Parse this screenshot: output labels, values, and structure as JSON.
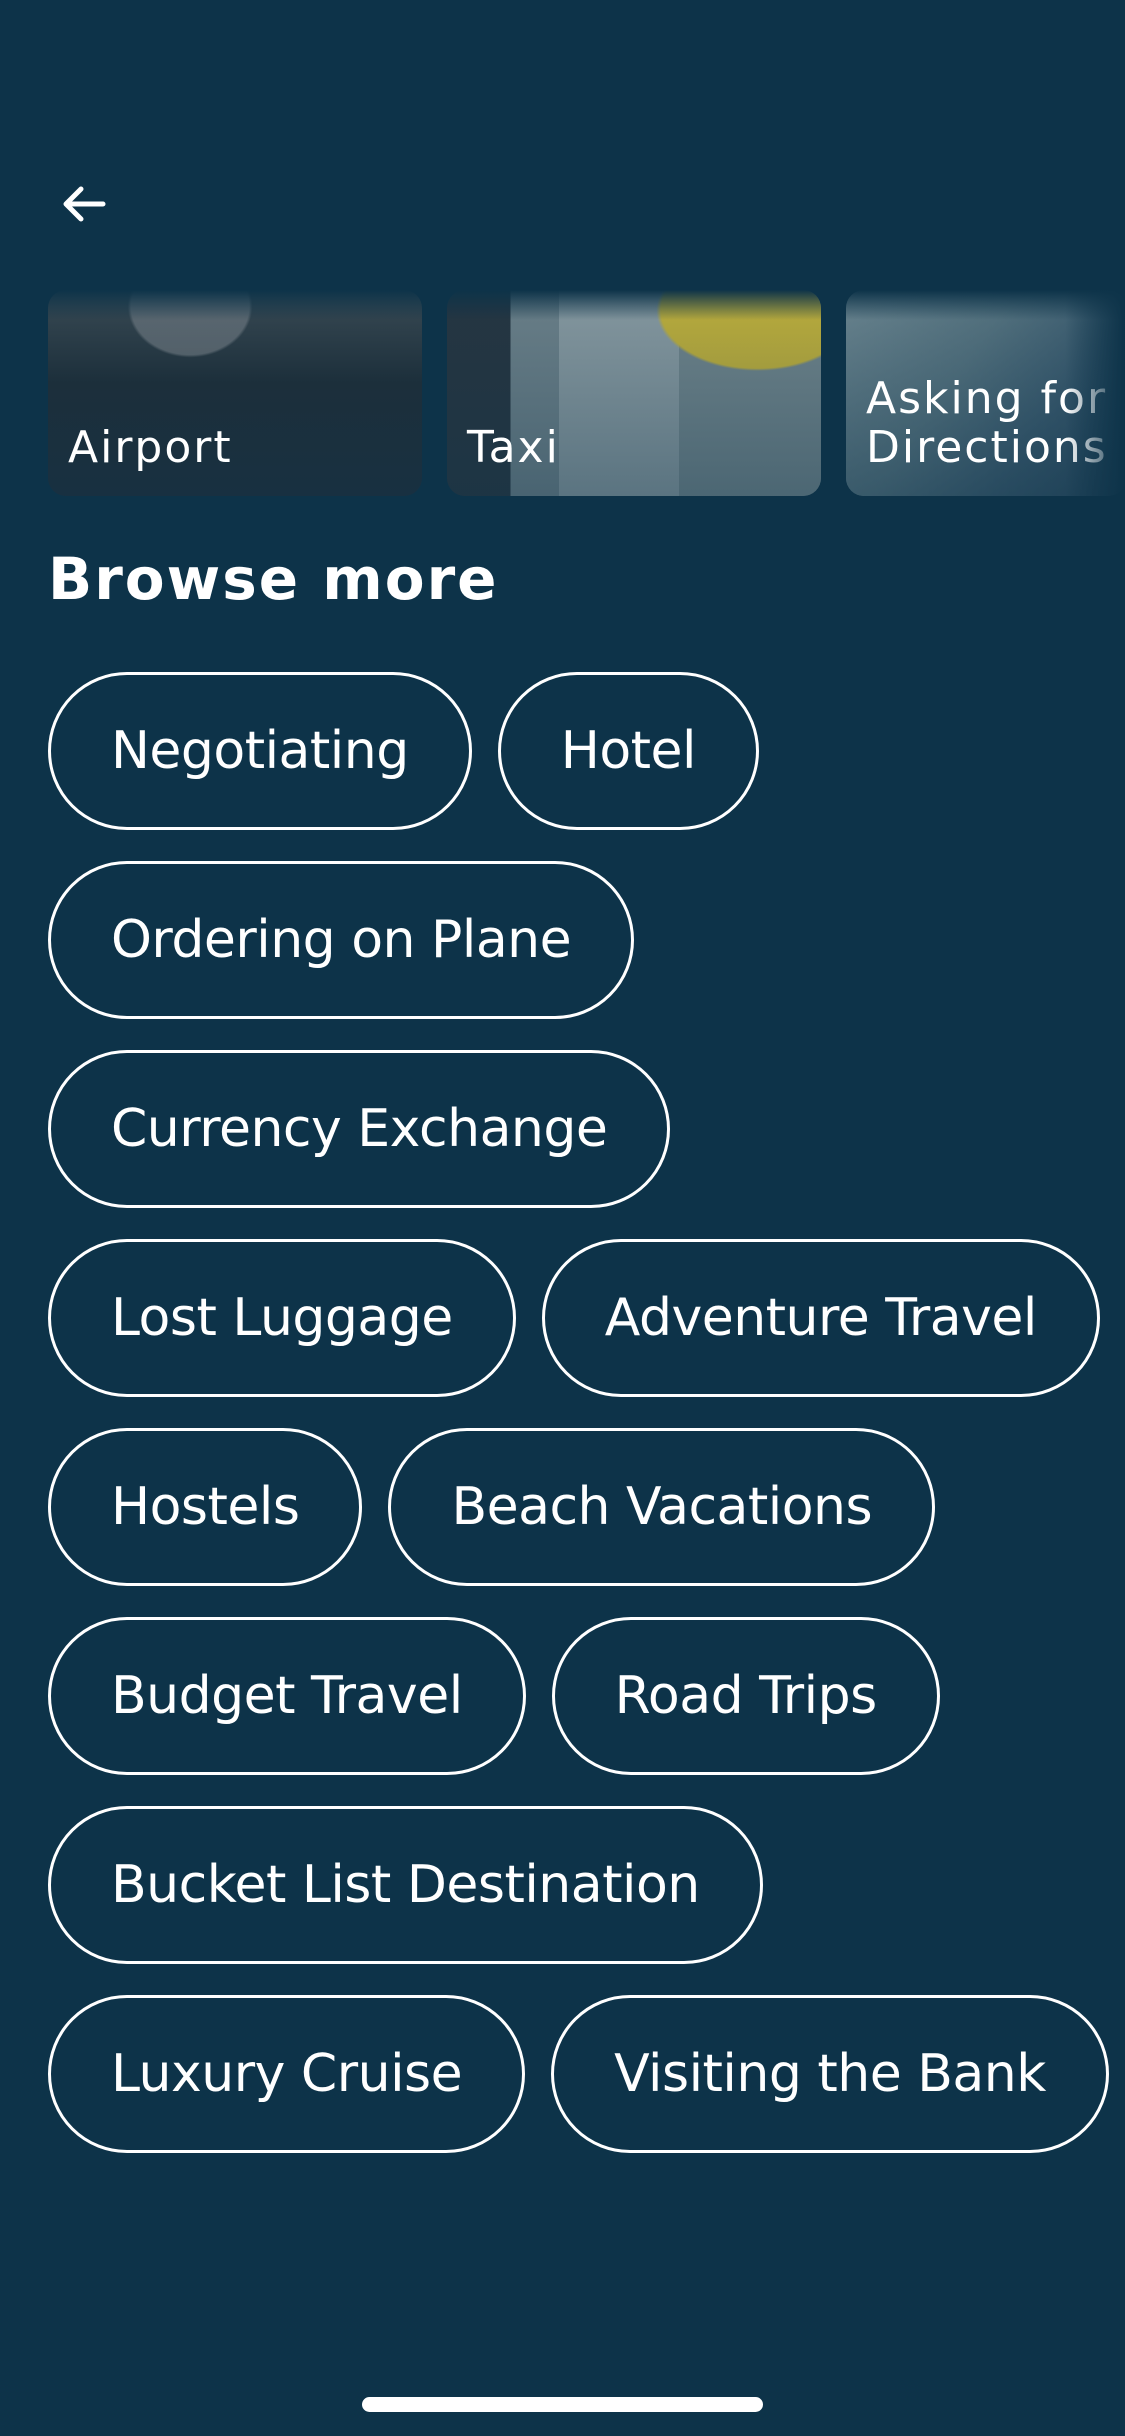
{
  "header": {
    "back_icon": "arrow-left-icon"
  },
  "carousel": {
    "cards": [
      {
        "label": "Airport"
      },
      {
        "label": "Taxi"
      },
      {
        "label": "Asking for\nDirections"
      }
    ]
  },
  "browse": {
    "title": "Browse more",
    "rows": [
      [
        "Negotiating",
        "Hotel"
      ],
      [
        "Ordering on Plane"
      ],
      [
        "Currency Exchange"
      ],
      [
        "Lost Luggage",
        "Adventure Travel"
      ],
      [
        "Hostels",
        "Beach Vacations"
      ],
      [
        "Budget Travel",
        "Road Trips"
      ],
      [
        "Bucket List Destination"
      ],
      [
        "Luxury Cruise",
        "Visiting the Bank"
      ]
    ]
  },
  "colors": {
    "background": "#0d3349",
    "chip_border": "#ffffff",
    "text": "#ffffff"
  }
}
